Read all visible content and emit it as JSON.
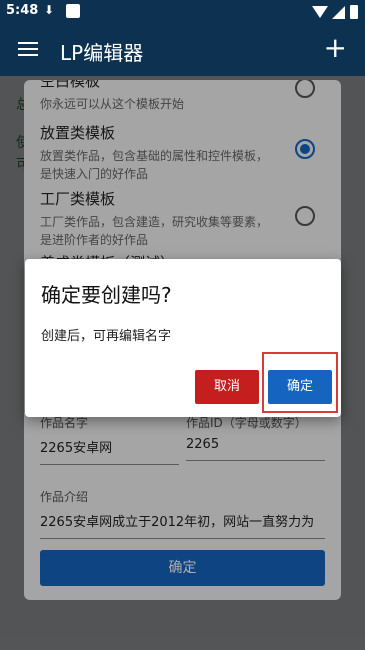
{
  "status_bar": {
    "time": "5:48"
  },
  "app_bar": {
    "title": "LP编辑器",
    "add_icon": "+"
  },
  "background": {
    "side_glyphs": [
      "总",
      "使",
      "可"
    ]
  },
  "template_sheet": {
    "templates": [
      {
        "name": "空白模板",
        "desc": "你永远可以从这个模板开始",
        "selected": false
      },
      {
        "name": "放置类模板",
        "desc": "放置类作品，包含基础的属性和控件模板，是快速入门的好作品",
        "selected": true
      },
      {
        "name": "工厂类模板",
        "desc": "工厂类作品，包含建造，研究收集等要素，是进阶作者的好作品",
        "selected": false
      },
      {
        "name": "养成类模板（测试）",
        "desc": "",
        "selected": false
      }
    ],
    "fields": {
      "work_name": {
        "label": "作品名字",
        "value": "2265安卓网"
      },
      "work_id": {
        "label": "作品ID（字母或数字）",
        "value": "2265"
      },
      "work_intro": {
        "label": "作品介绍",
        "value": "2265安卓网成立于2012年初，网站一直努力为"
      }
    },
    "confirm_label": "确定"
  },
  "dialog": {
    "title": "确定要创建吗?",
    "message": "创建后，可再编辑名字",
    "cancel_label": "取消",
    "ok_label": "确定"
  },
  "colors": {
    "app_bar": "#0d3150",
    "primary": "#1565c0",
    "cancel": "#c41e1e",
    "highlight": "#d93a3a"
  }
}
